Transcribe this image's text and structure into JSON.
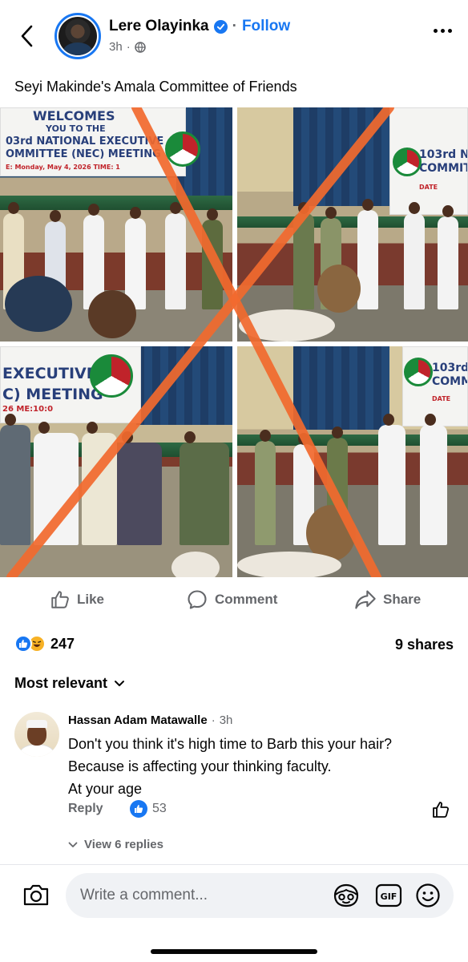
{
  "post": {
    "author": "Lere Olayinka",
    "follow_label": "Follow",
    "time": "3h",
    "caption": "Seyi Makinde's Amala Committee of Friends",
    "image_banner": {
      "left_top_line1": "WELCOMES",
      "left_top_line2": "YOU TO THE",
      "left_top_line3": "03rd NATIONAL EXECUTIVE",
      "left_top_line4": "OMMITTEE (NEC) MEETING",
      "left_top_line5": "E: Monday, May 4, 2026  TIME: 1",
      "right_top_line1": "103rd NA",
      "right_top_line2": "COMMITT",
      "right_top_line3": "DATE",
      "left_bottom_line1": "EXECUTIVE",
      "left_bottom_line2": "C) MEETING",
      "left_bottom_line3": "26  ME:10:0",
      "right_bottom_line1": "103rd I",
      "right_bottom_line2": "COMM",
      "right_bottom_line3": "DATE"
    }
  },
  "actions": {
    "like": "Like",
    "comment": "Comment",
    "share": "Share"
  },
  "stats": {
    "reaction_count": "247",
    "shares": "9 shares"
  },
  "sort_label": "Most relevant",
  "comment": {
    "author": "Hassan Adam Matawalle",
    "time": "3h",
    "lines": [
      "Don't you think it's high time to Barb this your hair?",
      "Because is affecting your thinking faculty.",
      "At your age"
    ],
    "reply_label": "Reply",
    "like_count": "53",
    "view_replies": "View 6 replies"
  },
  "composer": {
    "placeholder": "Write a comment..."
  },
  "colors": {
    "accent": "#1877f2",
    "muted": "#65676b",
    "x_mark": "#f26a2e"
  },
  "icons": [
    "back-arrow-icon",
    "verified-badge-icon",
    "globe-icon",
    "more-icon",
    "like-icon",
    "comment-icon",
    "share-icon",
    "like-reaction-icon",
    "haha-reaction-icon",
    "chevron-down-icon",
    "thumbs-up-icon",
    "camera-icon",
    "avatar-sticker-icon",
    "gif-icon",
    "emoji-icon"
  ]
}
